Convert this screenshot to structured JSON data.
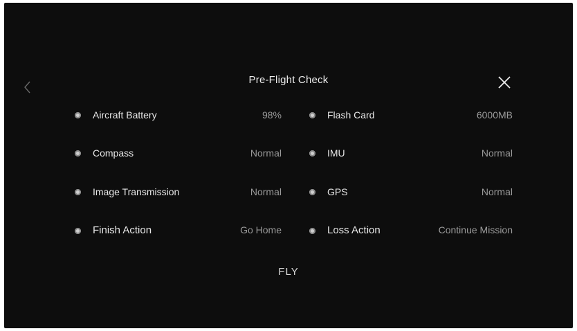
{
  "header": {
    "title": "Pre-Flight Check"
  },
  "icons": {
    "back": "chevron-left-icon",
    "close": "close-icon",
    "status": "status-dot-icon"
  },
  "checks": {
    "left": [
      {
        "label": "Aircraft Battery",
        "value": "98%"
      },
      {
        "label": "Compass",
        "value": "Normal"
      },
      {
        "label": "Image Transmission",
        "value": "Normal"
      },
      {
        "label": "Finish Action",
        "value": "Go Home"
      }
    ],
    "right": [
      {
        "label": "Flash Card",
        "value": "6000MB"
      },
      {
        "label": "IMU",
        "value": "Normal"
      },
      {
        "label": "GPS",
        "value": "Normal"
      },
      {
        "label": "Loss Action",
        "value": "Continue Mission"
      }
    ]
  },
  "actions": {
    "fly_label": "FLY"
  },
  "colors": {
    "background": "#0d0d0d",
    "text_primary": "#e8e8e8",
    "text_secondary": "#9a9a9a"
  }
}
